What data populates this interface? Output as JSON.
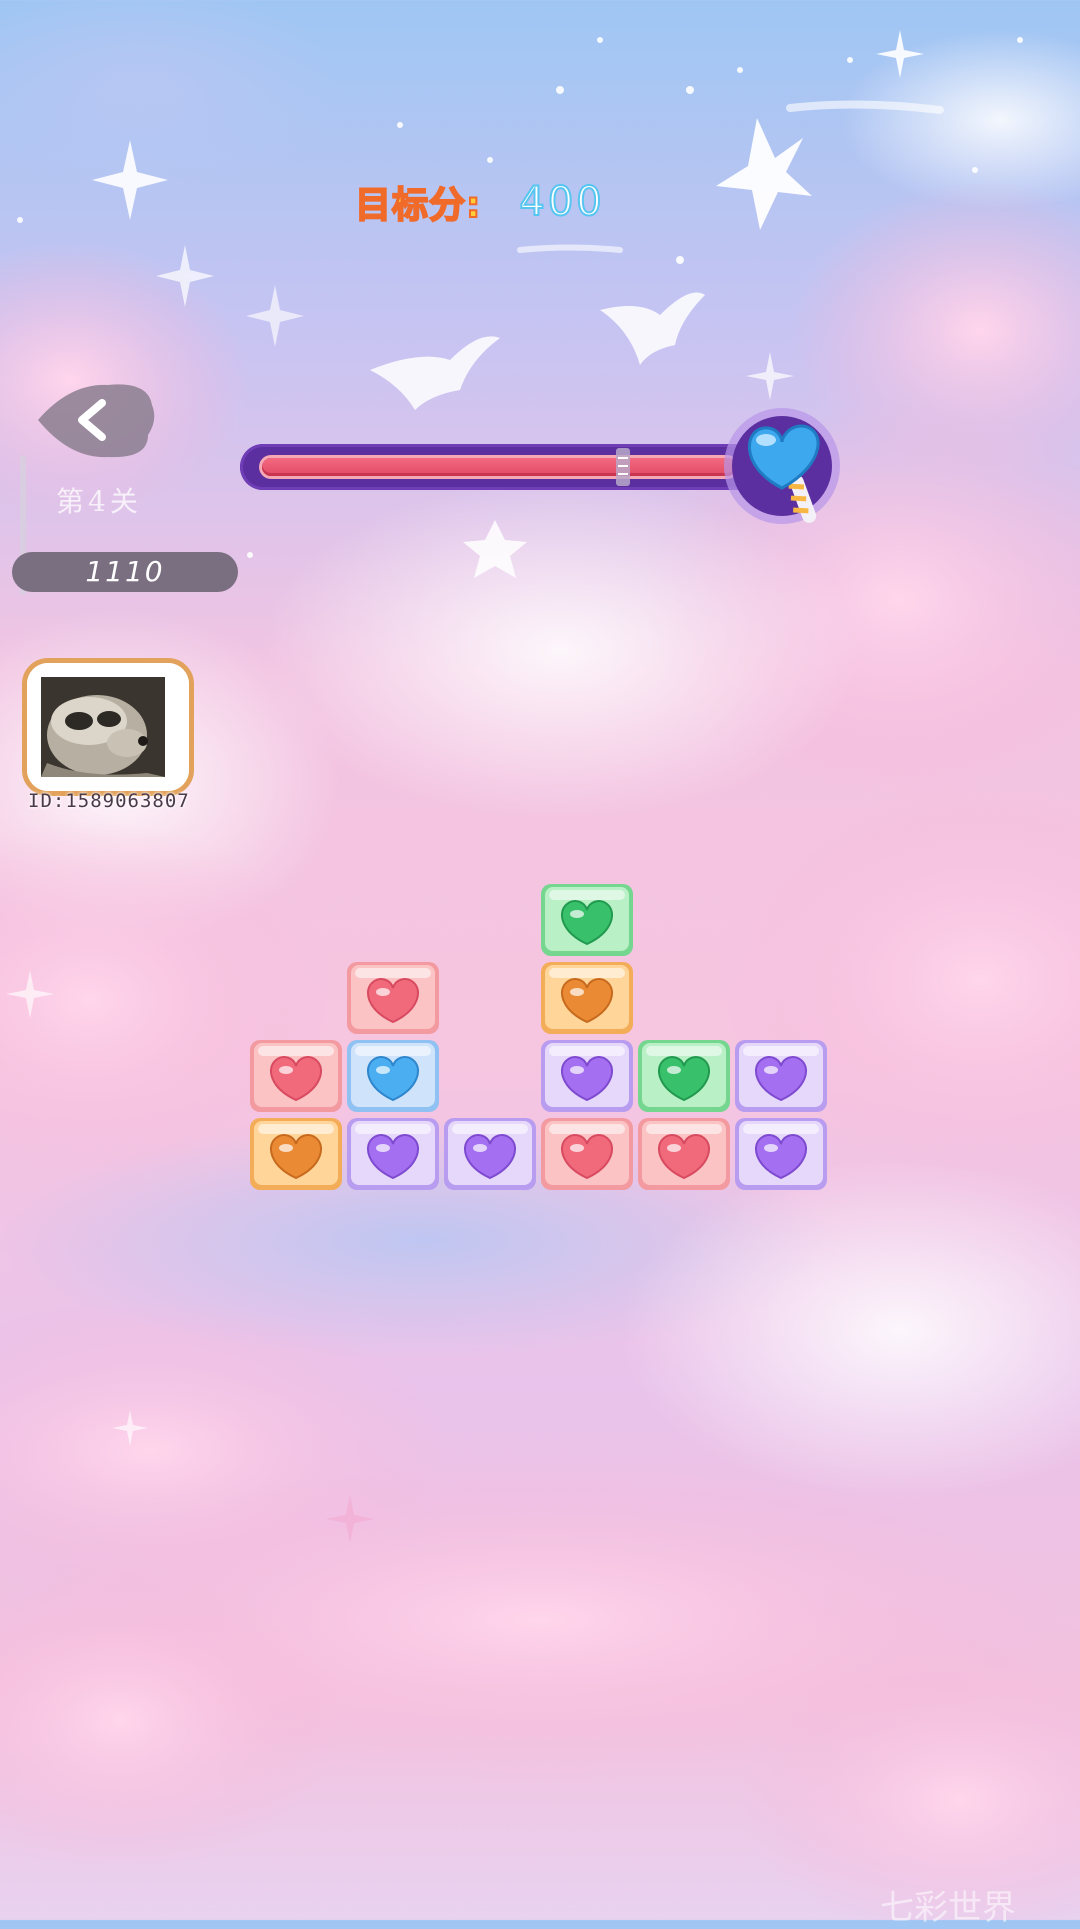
{
  "hud": {
    "target_label": "目标分:",
    "target_value": "400",
    "level_label": "第4关",
    "score": "1110",
    "player_id": "ID:1589063807",
    "progress_fraction": 0.85
  },
  "icons": {
    "back": "chevron-left-icon",
    "avatar": "raccoon-avatar",
    "goal": "lollipop-icon"
  },
  "colors": {
    "target_label": "#ffcf3a",
    "target_value_stroke": "#56c6f0",
    "progress_track": "#5b2fa0",
    "progress_fill": "#e24a63"
  },
  "board": {
    "columns": 6,
    "rows": 4,
    "cells": [
      {
        "col": 3,
        "row": 0,
        "color": "green"
      },
      {
        "col": 1,
        "row": 1,
        "color": "red"
      },
      {
        "col": 3,
        "row": 1,
        "color": "orange"
      },
      {
        "col": 0,
        "row": 2,
        "color": "red"
      },
      {
        "col": 1,
        "row": 2,
        "color": "blue"
      },
      {
        "col": 3,
        "row": 2,
        "color": "purple"
      },
      {
        "col": 4,
        "row": 2,
        "color": "green"
      },
      {
        "col": 5,
        "row": 2,
        "color": "purple"
      },
      {
        "col": 0,
        "row": 3,
        "color": "orange"
      },
      {
        "col": 1,
        "row": 3,
        "color": "purple"
      },
      {
        "col": 2,
        "row": 3,
        "color": "purple"
      },
      {
        "col": 3,
        "row": 3,
        "color": "red"
      },
      {
        "col": 4,
        "row": 3,
        "color": "red"
      },
      {
        "col": 5,
        "row": 3,
        "color": "purple"
      }
    ]
  },
  "watermark": "七彩世界"
}
